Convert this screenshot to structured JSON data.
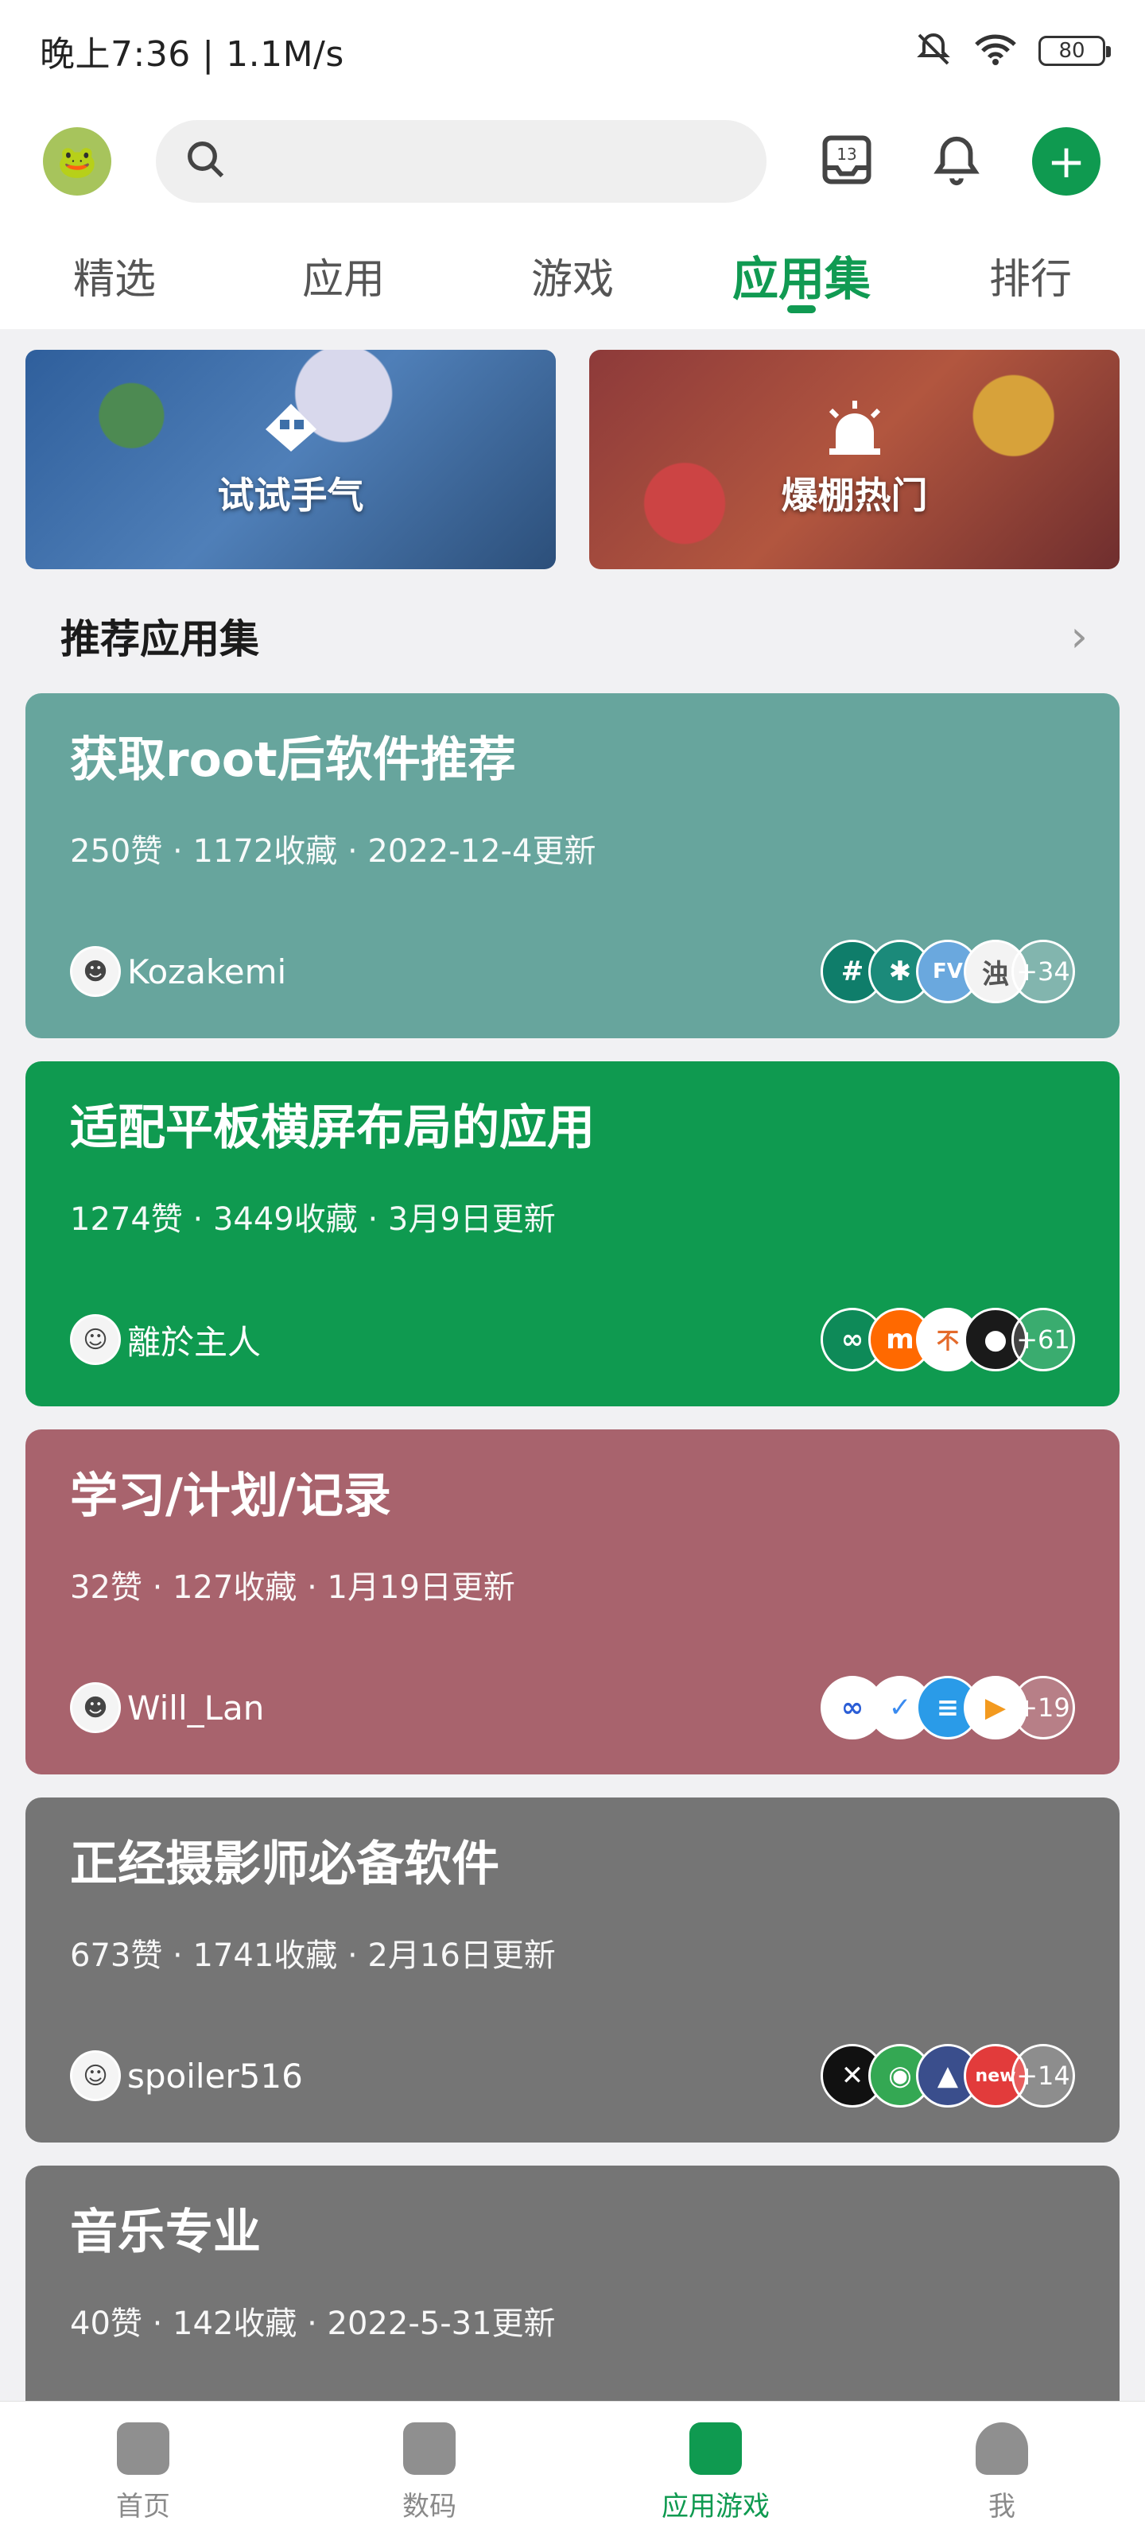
{
  "status": {
    "time": "晚上7:36 | 1.1M/s",
    "battery": "80"
  },
  "colors": {
    "accent": "#0f9a50",
    "card1": "#67a59d",
    "card2": "#0f9a50",
    "card3": "#a8636d",
    "card4": "#757575",
    "card5": "#757575"
  },
  "header": {
    "inbox_badge": "13"
  },
  "tabs": [
    "精选",
    "应用",
    "游戏",
    "应用集",
    "排行"
  ],
  "active_tab_index": 3,
  "banners": [
    {
      "label": "试试手气",
      "icon": "dice-icon"
    },
    {
      "label": "爆棚热门",
      "icon": "siren-icon"
    }
  ],
  "section": {
    "title": "推荐应用集"
  },
  "cards": [
    {
      "title": "获取root后软件推荐",
      "meta": "250赞 · 1172收藏 · 2022-12-4更新",
      "user": "Kozakemi",
      "more": "+34"
    },
    {
      "title": "适配平板横屏布局的应用",
      "meta": "1274赞 · 3449收藏 · 3月9日更新",
      "user": "離於主人",
      "more": "+61"
    },
    {
      "title": "学习/计划/记录",
      "meta": "32赞 · 127收藏 · 1月19日更新",
      "user": "Will_Lan",
      "more": "+19"
    },
    {
      "title": "正经摄影师必备软件",
      "meta": "673赞 · 1741收藏 · 2月16日更新",
      "user": "spoiler516",
      "more": "+14"
    },
    {
      "title": "音乐专业",
      "meta": "40赞 · 142收藏 · 2022-5-31更新",
      "user": "",
      "more": ""
    }
  ],
  "bottom_nav": [
    "首页",
    "数码",
    "应用游戏",
    "我"
  ],
  "active_nav_index": 2
}
